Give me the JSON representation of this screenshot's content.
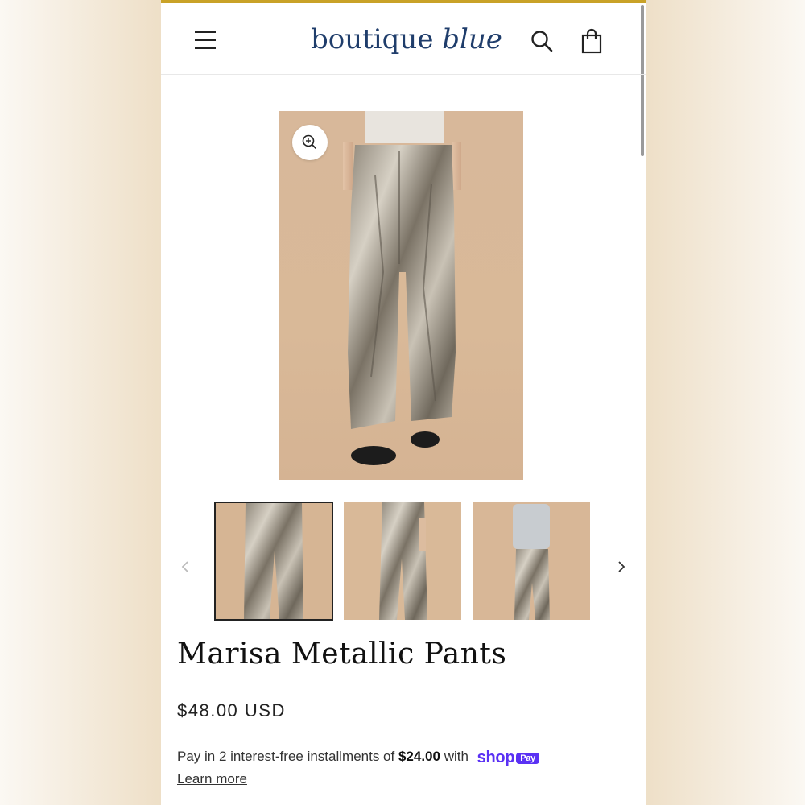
{
  "header": {
    "logo_part1": "boutique",
    "logo_part2": "blue",
    "menu_icon": "hamburger-menu-icon",
    "search_icon": "search-icon",
    "cart_icon": "shopping-bag-icon"
  },
  "gallery": {
    "zoom_icon": "zoom-in-icon",
    "prev_icon": "chevron-left-icon",
    "next_icon": "chevron-right-icon"
  },
  "product": {
    "title": "Marisa Metallic Pants",
    "price": "$48.00 USD",
    "installments_prefix": "Pay in 2 interest-free installments of",
    "installment_amount": "$24.00",
    "installments_suffix": "with",
    "shop_brand": "shop",
    "pay_badge": "Pay",
    "learn_more": "Learn more"
  },
  "colors": {
    "accent_top": "#c9a227",
    "brand_blue": "#1f3d6b",
    "shop_pay_purple": "#5a31f4"
  }
}
